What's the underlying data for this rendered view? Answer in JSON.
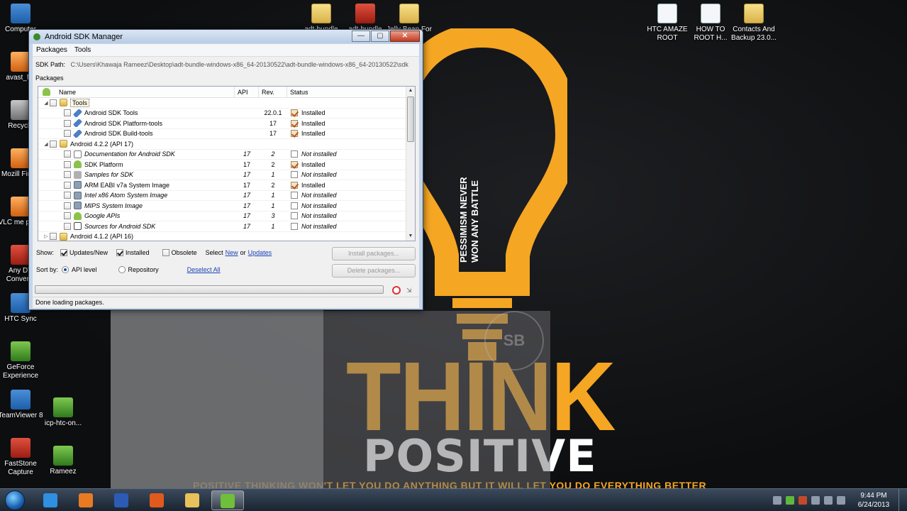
{
  "wallpaper": {
    "headline": "THINK",
    "subheadline": "POSITIVE",
    "bulb_text_line1": "PESSIMISM NEVER",
    "bulb_text_line2": "WON ANY BATTLE",
    "slogan": "POSITIVE THINKING WON'T LET YOU DO ANYTHING BUT IT WILL LET YOU DO EVERYTHING BETTER",
    "seal": "SB",
    "accent_color": "#f5a623"
  },
  "desktop": {
    "left_icons": [
      {
        "label": "Computer",
        "icon": "computer-icon"
      },
      {
        "label": "avast_fre",
        "icon": "avast-icon"
      },
      {
        "label": "Recycle",
        "icon": "recycle-bin-icon"
      },
      {
        "label": "Mozill Firefo",
        "icon": "firefox-icon"
      },
      {
        "label": "VLC me playe",
        "icon": "vlc-icon"
      },
      {
        "label": "Any DV Converte",
        "icon": "dvd-converter-icon"
      },
      {
        "label": "HTC Sync",
        "icon": "htc-sync-icon"
      },
      {
        "label": "GeForce Experience",
        "icon": "geforce-icon"
      },
      {
        "label": "TeamViewer 8",
        "icon": "teamviewer-icon"
      },
      {
        "label": "FastStone Capture",
        "icon": "faststone-icon"
      }
    ],
    "mid_icons": [
      {
        "label": "icp-htc-on...",
        "icon": "image-icon"
      },
      {
        "label": "Rameez",
        "icon": "image-icon"
      }
    ],
    "top_icons": [
      {
        "label": "adt-bundle",
        "icon": "folder-icon"
      },
      {
        "label": "adt-bundle",
        "icon": "archive-icon"
      },
      {
        "label": "Jelly Bean For",
        "icon": "folder-icon"
      }
    ],
    "right_icons": [
      {
        "label": "HTC AMAZE ROOT",
        "icon": "word-doc-icon"
      },
      {
        "label": "HOW TO ROOT H...",
        "icon": "word-doc-icon"
      },
      {
        "label": "Contacts And Backup 23.0...",
        "icon": "folder-icon"
      }
    ]
  },
  "window": {
    "title": "Android SDK Manager",
    "buttons": {
      "minimize": "—",
      "maximize": "▢",
      "close": "✕"
    },
    "menu": [
      "Packages",
      "Tools"
    ],
    "sdk_path_label": "SDK Path:",
    "sdk_path_value": "C:\\Users\\Khawaja Rameez\\Desktop\\adt-bundle-windows-x86_64-20130522\\adt-bundle-windows-x86_64-20130522\\sdk",
    "packages_label": "Packages",
    "columns": {
      "name": "Name",
      "api": "API",
      "rev": "Rev.",
      "status": "Status"
    },
    "rows": [
      {
        "level": 0,
        "expander": "◢",
        "icon": "folder",
        "name": "Tools",
        "api": "",
        "rev": "",
        "status": "",
        "italic": false,
        "selected": true
      },
      {
        "level": 1,
        "expander": "",
        "icon": "tool",
        "name": "Android SDK Tools",
        "api": "",
        "rev": "22.0.1",
        "status": "Installed",
        "italic": false
      },
      {
        "level": 1,
        "expander": "",
        "icon": "tool",
        "name": "Android SDK Platform-tools",
        "api": "",
        "rev": "17",
        "status": "Installed",
        "italic": false
      },
      {
        "level": 1,
        "expander": "",
        "icon": "tool",
        "name": "Android SDK Build-tools",
        "api": "",
        "rev": "17",
        "status": "Installed",
        "italic": false
      },
      {
        "level": 0,
        "expander": "◢",
        "icon": "folder",
        "name": "Android 4.2.2 (API 17)",
        "api": "",
        "rev": "",
        "status": "",
        "italic": false
      },
      {
        "level": 1,
        "expander": "",
        "icon": "doc",
        "name": "Documentation for Android SDK",
        "api": "17",
        "rev": "2",
        "status": "Not installed",
        "italic": true
      },
      {
        "level": 1,
        "expander": "",
        "icon": "android",
        "name": "SDK Platform",
        "api": "17",
        "rev": "2",
        "status": "Installed",
        "italic": false
      },
      {
        "level": 1,
        "expander": "",
        "icon": "sample",
        "name": "Samples for SDK",
        "api": "17",
        "rev": "1",
        "status": "Not installed",
        "italic": true
      },
      {
        "level": 1,
        "expander": "",
        "icon": "img",
        "name": "ARM EABI v7a System Image",
        "api": "17",
        "rev": "2",
        "status": "Installed",
        "italic": false
      },
      {
        "level": 1,
        "expander": "",
        "icon": "img",
        "name": "Intel x86 Atom System Image",
        "api": "17",
        "rev": "1",
        "status": "Not installed",
        "italic": true
      },
      {
        "level": 1,
        "expander": "",
        "icon": "img",
        "name": "MIPS System Image",
        "api": "17",
        "rev": "1",
        "status": "Not installed",
        "italic": true
      },
      {
        "level": 1,
        "expander": "",
        "icon": "android",
        "name": "Google APIs",
        "api": "17",
        "rev": "3",
        "status": "Not installed",
        "italic": true
      },
      {
        "level": 1,
        "expander": "",
        "icon": "src",
        "name": "Sources for Android SDK",
        "api": "17",
        "rev": "1",
        "status": "Not installed",
        "italic": true
      },
      {
        "level": 0,
        "expander": "▷",
        "icon": "folder",
        "name": "Android 4.1.2 (API 16)",
        "api": "",
        "rev": "",
        "status": "",
        "italic": false
      }
    ],
    "show_label": "Show:",
    "updates_new_label": "Updates/New",
    "installed_label": "Installed",
    "obsolete_label": "Obsolete",
    "select_prefix": "Select",
    "select_new": "New",
    "select_or": "or",
    "select_updates": "Updates",
    "sort_label": "Sort by:",
    "api_level_label": "API level",
    "repository_label": "Repository",
    "deselect_all": "Deselect All",
    "install_button": "Install packages...",
    "delete_button": "Delete packages...",
    "status_text": "Done loading packages."
  },
  "taskbar": {
    "time": "9:44 PM",
    "date": "6/24/2013",
    "apps": [
      {
        "name": "internet-explorer-icon",
        "color": "#2f8fe0"
      },
      {
        "name": "media-player-icon",
        "color": "#e87b22"
      },
      {
        "name": "word-icon",
        "color": "#2b5bb5"
      },
      {
        "name": "firefox-icon",
        "color": "#e05a1c"
      },
      {
        "name": "explorer-icon",
        "color": "#e8c15a"
      },
      {
        "name": "sdk-manager-icon",
        "color": "#6fbf3a"
      }
    ]
  }
}
